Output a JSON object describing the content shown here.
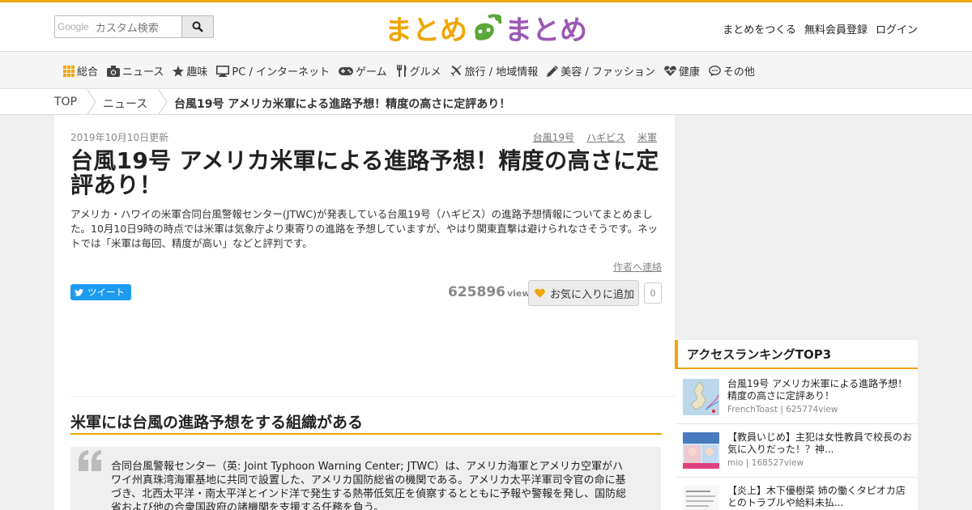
{
  "header": {
    "search_brand": "Google",
    "search_placeholder": "カスタム検索",
    "logo_text_left": "まとめ",
    "logo_text_right": "まとめ",
    "auth_links": [
      "まとめをつくる",
      "無料会員登録",
      "ログイン"
    ]
  },
  "nav": {
    "items": [
      {
        "label": "総合",
        "icon": "grid-icon"
      },
      {
        "label": "ニュース",
        "icon": "camera-icon"
      },
      {
        "label": "趣味",
        "icon": "star-icon"
      },
      {
        "label": "PC / インターネット",
        "icon": "monitor-icon"
      },
      {
        "label": "ゲーム",
        "icon": "gamepad-icon"
      },
      {
        "label": "グルメ",
        "icon": "fork-knife-icon"
      },
      {
        "label": "旅行 / 地域情報",
        "icon": "airplane-icon"
      },
      {
        "label": "美容 / ファッション",
        "icon": "pen-icon"
      },
      {
        "label": "健康",
        "icon": "heartbeat-icon"
      },
      {
        "label": "その他",
        "icon": "bubble-icon"
      }
    ]
  },
  "breadcrumb": [
    "TOP",
    "ニュース",
    "台風19号 アメリカ米軍による進路予想！精度の高さに定評あり！"
  ],
  "article": {
    "updated": "2019年10月10日更新",
    "tags": [
      "台風19号",
      "ハギビス",
      "米軍"
    ],
    "title": "台風19号 アメリカ米軍による進路予想！精度の高さに定評あり！",
    "lead": "アメリカ・ハワイの米軍合同台風警報センター(JTWC)が発表している台風19号（ハギビス）の進路予想情報についてまとめました。10月10日9時の時点では米軍は気象庁より東寄りの進路を予想していますが、やはり関東直撃は避けられなさそうです。ネットでは「米軍は毎回、精度が高い」などと評判です。",
    "contact_author": "作者へ連絡",
    "tweet_label": "ツイート",
    "views": "625896",
    "views_unit": "view",
    "fav_label": "お気に入りに追加",
    "fav_count": "0",
    "section_heading": "米軍には台風の進路予想をする組織がある",
    "quote": "合同台風警報センター（英: Joint Typhoon Warning Center; JTWC）は、アメリカ海軍とアメリカ空軍がハワイ州真珠湾海軍基地に共同で設置した、アメリカ国防総省の機関である。アメリカ太平洋軍司令官の命に基づき、北西太平洋・南太平洋とインド洋で発生する熱帯低気圧を偵察するとともに予報や警報を発し、国防総省および他の合衆国政府の諸機関を支援する任務を負う。"
  },
  "sidebar": {
    "ranking_title": "アクセスランキングTOP3",
    "items": [
      {
        "title": "台風19号 アメリカ米軍による進路予想！精度の高さに定評あり！",
        "meta": "FrenchToast | 625774view"
      },
      {
        "title": "【教員いじめ】主犯は女性教員で校長のお気に入りだった！？神...",
        "meta": "mio | 168527view"
      },
      {
        "title": "【炎上】木下優樹菜 姉の働くタピオカ店とのトラブルや給料未払...",
        "meta": ""
      }
    ]
  },
  "colors": {
    "accent": "#f0a500",
    "twitter": "#1d9bf0",
    "logo_orange": "#f0a500",
    "logo_purple": "#9b59b6",
    "logo_green": "#4caf50"
  }
}
